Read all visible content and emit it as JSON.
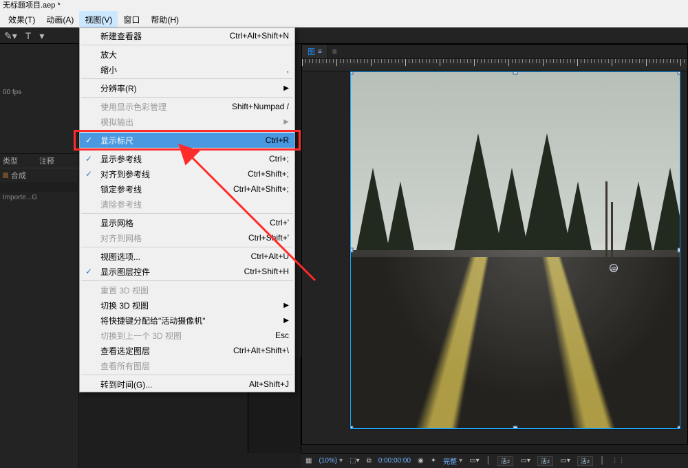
{
  "title": "无标题项目.aep *",
  "menu": [
    {
      "label": "效果(T)",
      "active": false
    },
    {
      "label": "动画(A)",
      "active": false
    },
    {
      "label": "视图(V)",
      "active": true
    },
    {
      "label": "窗口",
      "active": false
    },
    {
      "label": "帮助(H)",
      "active": false
    }
  ],
  "project": {
    "fps": "00 fps"
  },
  "panel": {
    "col_type": "类型",
    "col_note": "注释",
    "row_kind": "合成",
    "importe": "Importe...G"
  },
  "dropdown": [
    {
      "type": "item",
      "label": "新建查看器",
      "short": "Ctrl+Alt+Shift+N"
    },
    {
      "type": "sep"
    },
    {
      "type": "item",
      "label": "放大"
    },
    {
      "type": "item",
      "label": "缩小",
      "short": ","
    },
    {
      "type": "sep"
    },
    {
      "type": "item",
      "label": "分辨率(R)",
      "submenu": true
    },
    {
      "type": "sep"
    },
    {
      "type": "item",
      "label": "使用显示色彩管理",
      "short": "Shift+Numpad /",
      "disabled": true
    },
    {
      "type": "item",
      "label": "模拟输出",
      "submenu": true,
      "disabled": true
    },
    {
      "type": "sep"
    },
    {
      "type": "item",
      "label": "显示标尺",
      "short": "Ctrl+R",
      "checked": true,
      "selected": true
    },
    {
      "type": "sep"
    },
    {
      "type": "item",
      "label": "显示参考线",
      "short": "Ctrl+;",
      "checked": true
    },
    {
      "type": "item",
      "label": "对齐到参考线",
      "short": "Ctrl+Shift+;",
      "checked": true
    },
    {
      "type": "item",
      "label": "锁定参考线",
      "short": "Ctrl+Alt+Shift+;"
    },
    {
      "type": "item",
      "label": "清除参考线",
      "disabled": true
    },
    {
      "type": "sep"
    },
    {
      "type": "item",
      "label": "显示网格",
      "short": "Ctrl+'"
    },
    {
      "type": "item",
      "label": "对齐到网格",
      "short": "Ctrl+Shift+'",
      "disabled": true
    },
    {
      "type": "sep"
    },
    {
      "type": "item",
      "label": "视图选项...",
      "short": "Ctrl+Alt+U"
    },
    {
      "type": "item",
      "label": "显示图层控件",
      "short": "Ctrl+Shift+H",
      "checked": true
    },
    {
      "type": "sep"
    },
    {
      "type": "item",
      "label": "重置 3D 视图",
      "disabled": true
    },
    {
      "type": "item",
      "label": "切换 3D 视图",
      "submenu": true
    },
    {
      "type": "item",
      "label": "将快捷键分配给\"活动摄像机\"",
      "submenu": true
    },
    {
      "type": "item",
      "label": "切换到上一个 3D 视图",
      "short": "Esc",
      "disabled": true
    },
    {
      "type": "item",
      "label": "查看选定图层",
      "short": "Ctrl+Alt+Shift+\\"
    },
    {
      "type": "item",
      "label": "查看所有图层",
      "disabled": true
    },
    {
      "type": "sep"
    },
    {
      "type": "item",
      "label": "转到时间(G)...",
      "short": "Alt+Shift+J"
    }
  ],
  "comp": {
    "tab": "图"
  },
  "status": {
    "zoom": "(10%)",
    "time": "0:00:00:00",
    "quality": "完整",
    "btn": "活z"
  }
}
